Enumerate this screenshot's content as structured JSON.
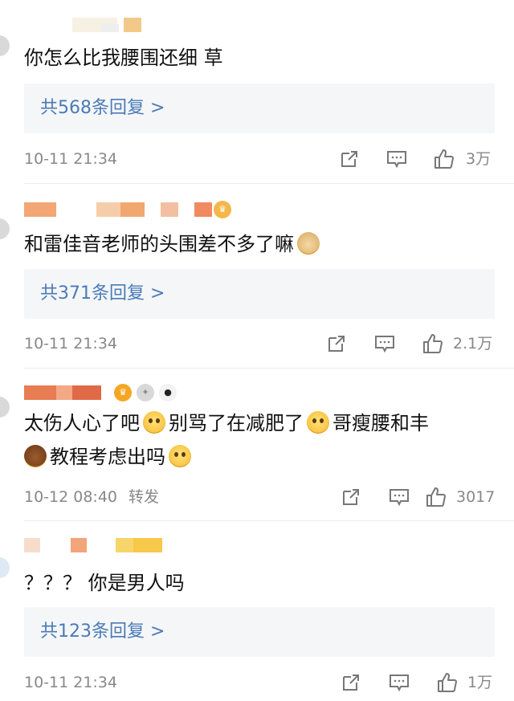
{
  "comments": [
    {
      "text": "你怎么比我腰围还细 草",
      "replies": "共568条回复 >",
      "time": "10-11 21:34",
      "likes": "3万",
      "colors": {
        "blocks": [
          "#f7f1e3",
          "#f3c98a"
        ]
      }
    },
    {
      "text": "和雷佳音老师的头围差不多了嘛",
      "emoji_after": "doge",
      "replies": "共371条回复 >",
      "time": "10-11 21:34",
      "likes": "2.1万",
      "colors": {
        "blocks": [
          "#f2a774",
          "#f6cda9",
          "#f0a870",
          "#f2c0a0",
          "#f08a60"
        ]
      }
    },
    {
      "text_part1": "太伤人心了吧",
      "text_part2": "别骂了在减肥了",
      "text_part3": "哥瘦腰和丰",
      "text_part4": "教程考虑出吗",
      "time": "10-12 08:40",
      "forward": "转发",
      "likes": "3017",
      "colors": {
        "blocks": [
          "#e87c52",
          "#f3a985",
          "#e06a48"
        ]
      }
    },
    {
      "text": "？？？ 你是男人吗",
      "replies": "共123条回复 >",
      "time": "10-11 21:34",
      "likes": "1万",
      "colors": {
        "blocks": [
          "#f7dccb",
          "#f2a47a",
          "#f7d56a",
          "#f7c84a"
        ]
      }
    }
  ]
}
